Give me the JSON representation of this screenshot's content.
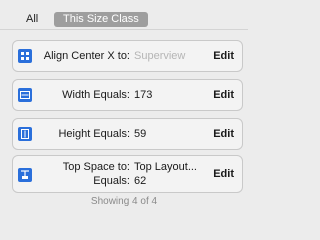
{
  "scope": {
    "all_label": "All",
    "size_class_label": "This Size Class"
  },
  "constraints": [
    {
      "label": "Align Center X to:",
      "value": "Superview",
      "edit": "Edit",
      "icon": "align-center-x-icon"
    },
    {
      "label": "Width Equals:",
      "value": "173",
      "edit": "Edit",
      "icon": "width-icon"
    },
    {
      "label": "Height Equals:",
      "value": "59",
      "edit": "Edit",
      "icon": "height-icon"
    },
    {
      "label_line1": "Top Space to:",
      "label_line2": "Equals:",
      "value_line1": "Top Layout...",
      "value_line2": "62",
      "edit": "Edit",
      "icon": "top-space-icon"
    }
  ],
  "footer": "Showing 4 of 4"
}
